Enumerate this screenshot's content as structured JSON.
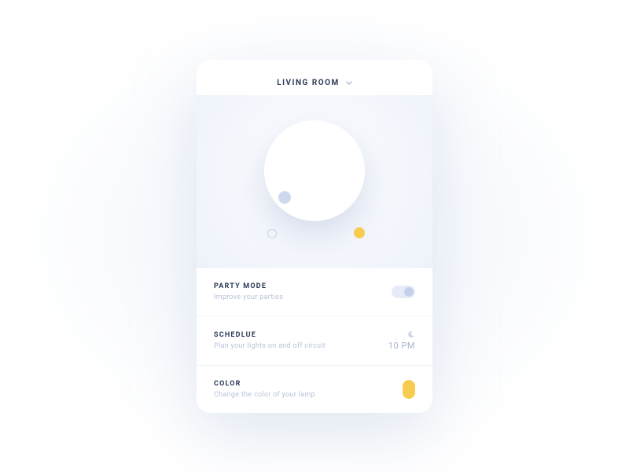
{
  "header": {
    "room_label": "LIVING ROOM"
  },
  "rows": {
    "party": {
      "title": "PARTY MODE",
      "sub": "Improve your parties"
    },
    "schedule": {
      "title": "SCHEDLUE",
      "sub": "Plan your lights on and off circuit",
      "time": "10 PM"
    },
    "color": {
      "title": "COLOR",
      "sub": "Change the color of your lamp"
    }
  },
  "colors": {
    "accent_yellow": "#f8cc4f",
    "accent_blue": "#cdd9ef"
  }
}
